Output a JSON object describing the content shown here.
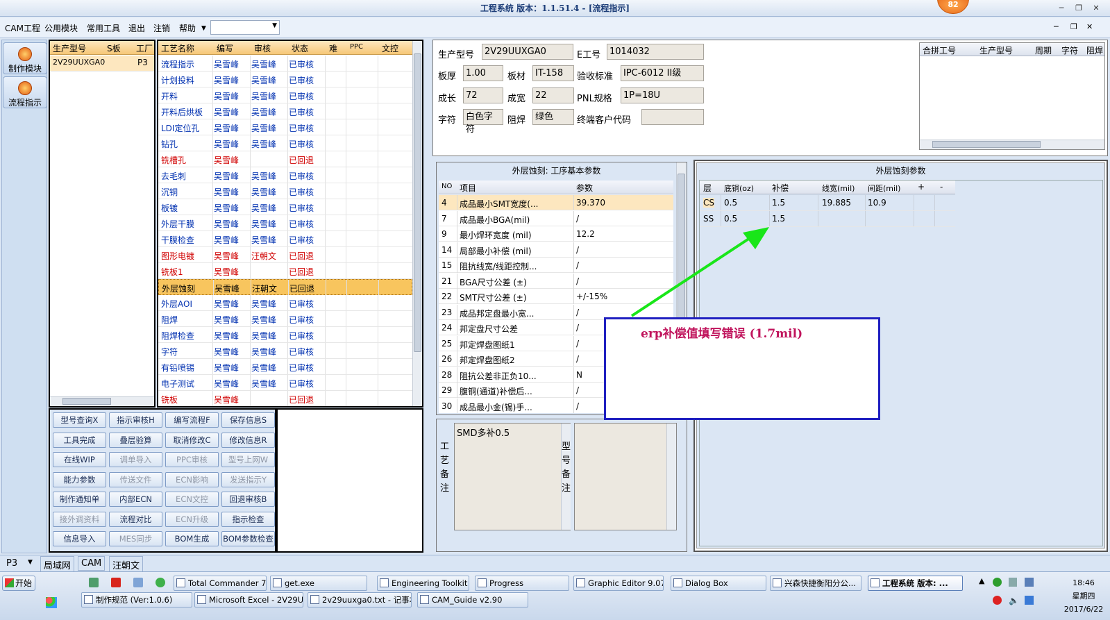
{
  "window": {
    "title": "工程系统  版本：1.1.51.4 - [流程指示]",
    "badge": "82"
  },
  "menu": [
    "CAM工程",
    "公用模块",
    "常用工具",
    "退出",
    "注销",
    "帮助"
  ],
  "left_nav": [
    {
      "label": "制作模块"
    },
    {
      "label": "流程指示"
    }
  ],
  "model_list": {
    "headers": [
      "生产型号",
      "S板",
      "工厂"
    ],
    "rows": [
      {
        "model": "2V29UUXGA0",
        "s": "",
        "plant": "P3"
      }
    ]
  },
  "process_grid": {
    "headers": [
      "工艺名称",
      "编写",
      "审核",
      "状态",
      "难",
      "PPC",
      "文控"
    ],
    "rows": [
      {
        "name": "流程指示",
        "writer": "吴雪峰",
        "reviewer": "吴雪峰",
        "status": "已审核",
        "red": false
      },
      {
        "name": "计划投料",
        "writer": "吴雪峰",
        "reviewer": "吴雪峰",
        "status": "已审核",
        "red": false
      },
      {
        "name": "开料",
        "writer": "吴雪峰",
        "reviewer": "吴雪峰",
        "status": "已审核",
        "red": false
      },
      {
        "name": "开料后烘板",
        "writer": "吴雪峰",
        "reviewer": "吴雪峰",
        "status": "已审核",
        "red": false
      },
      {
        "name": "LDI定位孔",
        "writer": "吴雪峰",
        "reviewer": "吴雪峰",
        "status": "已审核",
        "red": false
      },
      {
        "name": "钻孔",
        "writer": "吴雪峰",
        "reviewer": "吴雪峰",
        "status": "已审核",
        "red": false
      },
      {
        "name": "铣槽孔",
        "writer": "吴雪峰",
        "reviewer": "",
        "status": "已回退",
        "red": true
      },
      {
        "name": "去毛刺",
        "writer": "吴雪峰",
        "reviewer": "吴雪峰",
        "status": "已审核",
        "red": false
      },
      {
        "name": "沉铜",
        "writer": "吴雪峰",
        "reviewer": "吴雪峰",
        "status": "已审核",
        "red": false
      },
      {
        "name": "板镀",
        "writer": "吴雪峰",
        "reviewer": "吴雪峰",
        "status": "已审核",
        "red": false
      },
      {
        "name": "外层干膜",
        "writer": "吴雪峰",
        "reviewer": "吴雪峰",
        "status": "已审核",
        "red": false
      },
      {
        "name": "干膜检查",
        "writer": "吴雪峰",
        "reviewer": "吴雪峰",
        "status": "已审核",
        "red": false
      },
      {
        "name": "图形电镀",
        "writer": "吴雪峰",
        "reviewer": "汪朝文",
        "status": "已回退",
        "red": true
      },
      {
        "name": "铣板1",
        "writer": "吴雪峰",
        "reviewer": "",
        "status": "已回退",
        "red": true
      },
      {
        "name": "外层蚀刻",
        "writer": "吴雪峰",
        "reviewer": "汪朝文",
        "status": "已回退",
        "red": false,
        "selected": true
      },
      {
        "name": "外层AOI",
        "writer": "吴雪峰",
        "reviewer": "吴雪峰",
        "status": "已审核",
        "red": false
      },
      {
        "name": "阻焊",
        "writer": "吴雪峰",
        "reviewer": "吴雪峰",
        "status": "已审核",
        "red": false
      },
      {
        "name": "阻焊检查",
        "writer": "吴雪峰",
        "reviewer": "吴雪峰",
        "status": "已审核",
        "red": false
      },
      {
        "name": "字符",
        "writer": "吴雪峰",
        "reviewer": "吴雪峰",
        "status": "已审核",
        "red": false
      },
      {
        "name": "有铅喷锡",
        "writer": "吴雪峰",
        "reviewer": "吴雪峰",
        "status": "已审核",
        "red": false
      },
      {
        "name": "电子测试",
        "writer": "吴雪峰",
        "reviewer": "吴雪峰",
        "status": "已审核",
        "red": false
      },
      {
        "name": "铣板",
        "writer": "吴雪峰",
        "reviewer": "",
        "status": "已回退",
        "red": true
      }
    ]
  },
  "func_buttons": [
    [
      {
        "l": "型号查询X",
        "d": false
      },
      {
        "l": "指示审核H",
        "d": false
      },
      {
        "l": "编写流程F",
        "d": false
      },
      {
        "l": "保存信息S",
        "d": false
      }
    ],
    [
      {
        "l": "工具完成",
        "d": false
      },
      {
        "l": "叠层验算",
        "d": false
      },
      {
        "l": "取消修改C",
        "d": false
      },
      {
        "l": "修改信息R",
        "d": false
      }
    ],
    [
      {
        "l": "在线WIP",
        "d": false
      },
      {
        "l": "调单导入",
        "d": true
      },
      {
        "l": "PPC审核",
        "d": true
      },
      {
        "l": "型号上网W",
        "d": true
      }
    ],
    [
      {
        "l": "能力参数",
        "d": false
      },
      {
        "l": "传送文件",
        "d": true
      },
      {
        "l": "ECN影响",
        "d": true
      },
      {
        "l": "发送指示Y",
        "d": true
      }
    ],
    [
      {
        "l": "制作通知单",
        "d": false
      },
      {
        "l": "内部ECN",
        "d": false
      },
      {
        "l": "ECN文控",
        "d": true
      },
      {
        "l": "回退审核B",
        "d": false
      }
    ],
    [
      {
        "l": "接外调资料",
        "d": true
      },
      {
        "l": "流程对比",
        "d": false
      },
      {
        "l": "ECN升级",
        "d": true
      },
      {
        "l": "指示检查",
        "d": false
      }
    ],
    [
      {
        "l": "信息导入",
        "d": false
      },
      {
        "l": "MES同步",
        "d": true
      },
      {
        "l": "BOM生成",
        "d": false
      },
      {
        "l": "BOM参数检查",
        "d": false
      }
    ]
  ],
  "info": {
    "model_label": "生产型号",
    "model": "2V29UUXGA0",
    "e_label": "E工号",
    "e_no": "1014032",
    "thick_label": "板厚",
    "thick": "1.00",
    "mat_label": "板材",
    "mat": "IT-158",
    "std_label": "验收标准",
    "std": "IPC-6012 II级",
    "len_label": "成长",
    "len": "72",
    "wid_label": "成宽",
    "wid": "22",
    "pnl_label": "PNL规格",
    "pnl": "1P=18U",
    "char_label": "字符",
    "char": "白色字符",
    "mask_label": "阻焊",
    "mask": "绿色",
    "cust_label": "终端客户代码",
    "cust": ""
  },
  "combine_grid": {
    "headers": [
      "合拼工号",
      "生产型号",
      "周期",
      "字符",
      "阻焊"
    ]
  },
  "params_panel": {
    "title": "外层蚀刻: 工序基本参数",
    "headers": [
      "NO",
      "项目",
      "参数"
    ],
    "rows": [
      {
        "no": "4",
        "item": "成品最小SMT宽度(...",
        "val": "39.370"
      },
      {
        "no": "7",
        "item": "成品最小BGA(mil)",
        "val": "/"
      },
      {
        "no": "9",
        "item": "最小焊环宽度 (mil)",
        "val": "12.2"
      },
      {
        "no": "14",
        "item": "局部最小补偿 (mil)",
        "val": "/"
      },
      {
        "no": "15",
        "item": "阻抗线宽/线距控制...",
        "val": "/"
      },
      {
        "no": "21",
        "item": "BGA尺寸公差 (±)",
        "val": "/"
      },
      {
        "no": "22",
        "item": "SMT尺寸公差 (±)",
        "val": "+/-15%"
      },
      {
        "no": "23",
        "item": "成品邦定盘最小宽...",
        "val": "/"
      },
      {
        "no": "24",
        "item": "邦定盘尺寸公差",
        "val": "/"
      },
      {
        "no": "25",
        "item": "邦定焊盘图纸1",
        "val": "/"
      },
      {
        "no": "26",
        "item": "邦定焊盘图纸2",
        "val": "/"
      },
      {
        "no": "28",
        "item": "阻抗公差非正负10...",
        "val": "N"
      },
      {
        "no": "29",
        "item": "腹铜(通道)补偿后...",
        "val": "/"
      },
      {
        "no": "30",
        "item": "成品最小金(锡)手...",
        "val": "/"
      }
    ]
  },
  "etch_panel": {
    "title": "外层蚀刻参数",
    "headers": [
      "层",
      "底铜(oz)",
      "补偿",
      "线宽(mil)",
      "间距(mil)",
      "+",
      "-"
    ],
    "rows": [
      {
        "layer": "CS",
        "cu": "0.5",
        "comp": "1.5",
        "lw": "19.885",
        "sp": "10.9"
      },
      {
        "layer": "SS",
        "cu": "0.5",
        "comp": "1.5",
        "lw": "",
        "sp": ""
      }
    ]
  },
  "annotation": "erp补偿值填写错误 (1.7mil)",
  "notes": {
    "craft_label": "工艺备注",
    "craft_text": "SMD多补0.5",
    "model_label": "型号备注",
    "model_text": ""
  },
  "statusbar": {
    "plant": "P3",
    "tabs": [
      "局域网",
      "CAM",
      "汪朝文"
    ]
  },
  "taskbar": {
    "start": "开始",
    "row1": [
      "Total Commander 7....",
      "get.exe",
      "Engineering Toolkit 9...",
      "Progress",
      "Graphic Editor 9.07b...",
      "Dialog Box",
      "兴森快捷衡阳分公...",
      "工程系统 版本: ..."
    ],
    "row2": [
      "制作规范 (Ver:1.0.6)",
      "Microsoft Excel - 2V29UU...",
      "2v29uuxga0.txt - 记事本",
      "CAM_Guide v2.90"
    ],
    "time": "18:46",
    "weekday": "星期四",
    "date": "2017/6/22"
  },
  "colors": {
    "arrow": "#19e619",
    "annotation_text": "#c0145c",
    "annotation_border": "#2020c0",
    "selected_row": "#f8c55e"
  }
}
